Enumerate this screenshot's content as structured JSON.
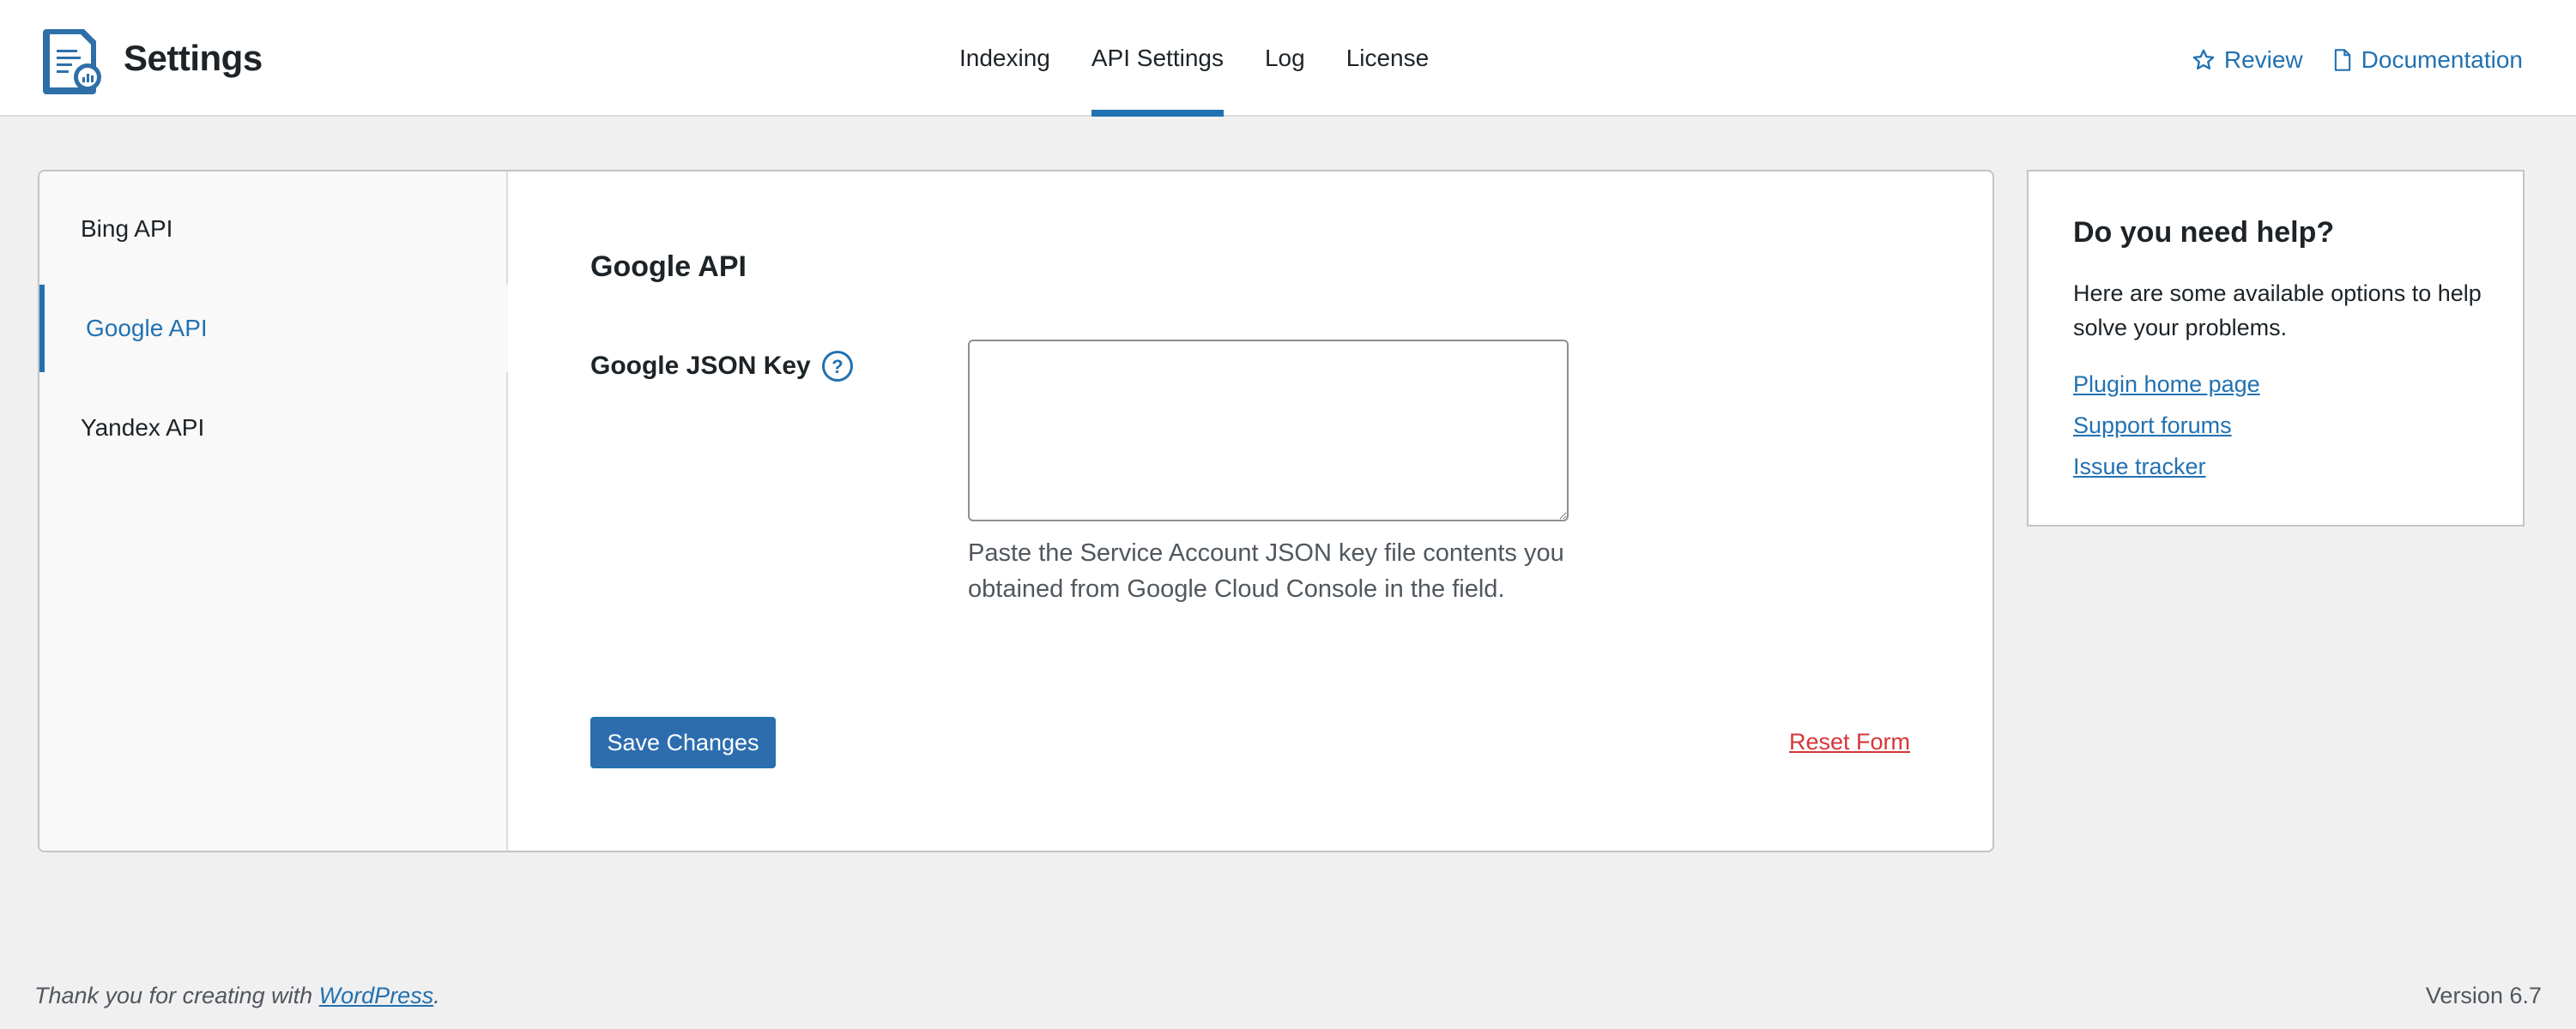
{
  "header": {
    "title": "Settings",
    "logo_icon": "document-chart-search-icon",
    "nav": [
      {
        "label": "Indexing",
        "active": false
      },
      {
        "label": "API Settings",
        "active": true
      },
      {
        "label": "Log",
        "active": false
      },
      {
        "label": "License",
        "active": false
      }
    ],
    "links": {
      "review": {
        "label": "Review",
        "icon": "star-icon"
      },
      "documentation": {
        "label": "Documentation",
        "icon": "page-icon"
      }
    }
  },
  "sidebar": {
    "items": [
      {
        "label": "Bing API",
        "active": false
      },
      {
        "label": "Google API",
        "active": true
      },
      {
        "label": "Yandex API",
        "active": false
      }
    ]
  },
  "content": {
    "section_title": "Google API",
    "field_label": "Google JSON Key",
    "field_value": "",
    "field_description": "Paste the Service Account JSON key file contents you obtained from Google Cloud Console in the field.",
    "save_label": "Save Changes",
    "reset_label": "Reset Form"
  },
  "help": {
    "title": "Do you need help?",
    "text": "Here are some available options to help solve your problems.",
    "links": [
      "Plugin home page",
      "Support forums",
      "Issue tracker"
    ]
  },
  "footer": {
    "thanks_prefix": "Thank you for creating with ",
    "thanks_link": "WordPress",
    "thanks_suffix": ".",
    "version": "Version 6.7"
  },
  "colors": {
    "accent": "#2271b1",
    "danger": "#d63638",
    "background": "#f0f0f1"
  }
}
